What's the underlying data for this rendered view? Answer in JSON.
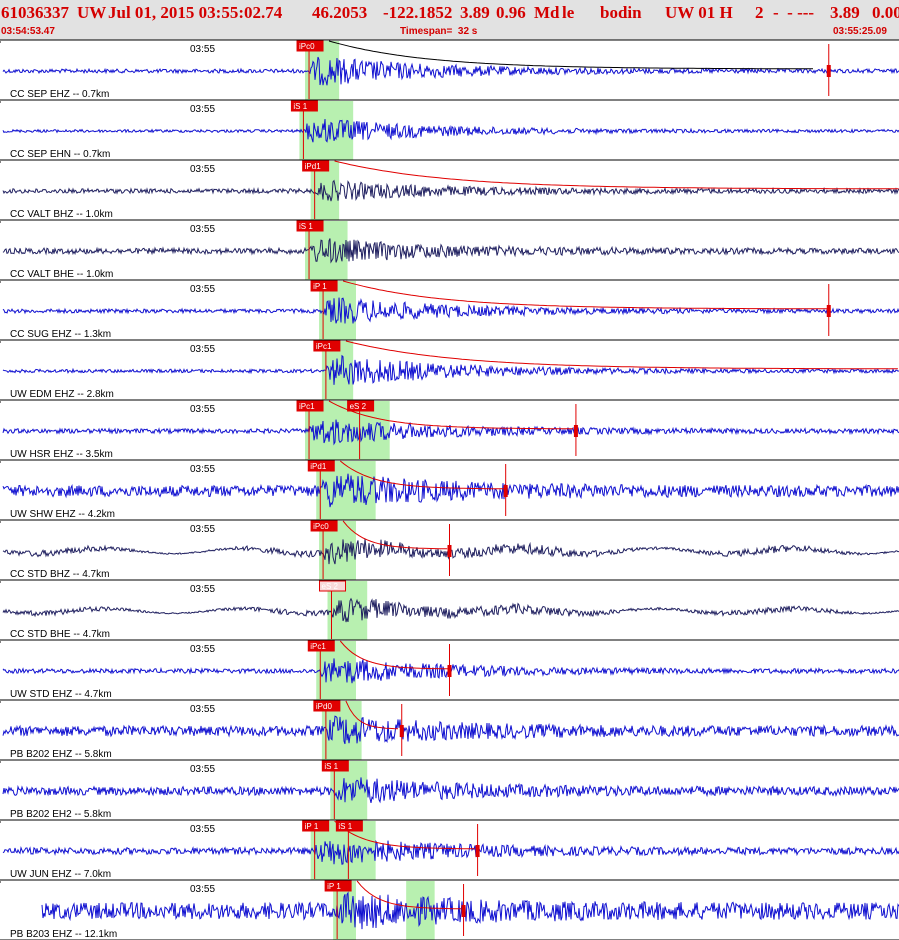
{
  "header": {
    "event_id": "61036337",
    "network": "UW",
    "origin_time": "Jul 01, 2015 03:55:02.74",
    "latitude": "46.2053",
    "longitude": "-122.1852",
    "depth": "3.89",
    "magnitude": "0.96",
    "mag_type": "Md",
    "loc_flag": "le",
    "author": "bodin",
    "source": "UW 01 H",
    "field_a": "2",
    "dashes": "-  - ---",
    "mag_repeat": "3.89",
    "residual": "0.00",
    "start_time": "03:54:53.47",
    "timespan": "Timespan=  32 s",
    "end_time": "03:55:25.09"
  },
  "colors": {
    "header_text": "#d40000",
    "header_bg": "#e2e2e2",
    "pick_box": "#e00000",
    "pick_box_light": "#f8d8d8",
    "window_band": "#b8f0b0",
    "waveform_blue": "#1010d0",
    "waveform_dark": "#202060",
    "coda_fit": "#e00000",
    "coda_fit_first": "#000000",
    "grid": "#000000"
  },
  "chart_data": {
    "type": "seismogram",
    "time_start": "03:54:53.47",
    "time_end": "03:55:25.09",
    "timespan_s": 32,
    "time_tick_label": "03:55",
    "traces": [
      {
        "label": "CC SEP EHZ -- 0.7km",
        "pick": "iPc0",
        "pick_t": 11.0,
        "band": [
          11.0,
          12.0
        ],
        "color": "blue",
        "amp": 0.55,
        "noise": 0.07,
        "coda_end": 29.0,
        "coda_black": true,
        "drop": 29.5,
        "end_t": 32.0
      },
      {
        "label": "CC SEP EHN -- 0.7km",
        "pick": "iS 1",
        "pick_t": 10.8,
        "band": [
          10.8,
          12.5
        ],
        "color": "blue",
        "amp": 0.5,
        "noise": 0.05,
        "end_t": 32.0
      },
      {
        "label": "CC VALT BHZ -- 1.0km",
        "pick": "iPd1",
        "pick_t": 11.2,
        "band": [
          11.2,
          12.0
        ],
        "color": "dark",
        "amp": 0.35,
        "noise": 0.08,
        "coda_end": 32.5,
        "drop": 33.0,
        "end_t": 32.0
      },
      {
        "label": "CC VALT BHE -- 1.0km",
        "pick": "iS 1",
        "pick_t": 11.0,
        "band": [
          11.0,
          12.3
        ],
        "color": "dark",
        "amp": 0.45,
        "noise": 0.1,
        "end_t": 32.0
      },
      {
        "label": "CC SUG EHZ -- 1.3km",
        "pick": "iP 1",
        "pick_t": 11.5,
        "band": [
          11.5,
          12.6
        ],
        "color": "blue",
        "amp": 0.5,
        "noise": 0.07,
        "coda_end": 29.5,
        "drop": 29.5,
        "end_t": 32.0
      },
      {
        "label": "UW EDM EHZ -- 2.8km",
        "pick": "iPc1",
        "pick_t": 11.6,
        "band": [
          11.6,
          12.5
        ],
        "color": "blue",
        "amp": 0.6,
        "noise": 0.06,
        "coda_end": 35.0,
        "end_t": 33.0
      },
      {
        "label": "UW HSR EHZ -- 3.5km",
        "pick": "iPc1",
        "pick_t": 11.0,
        "pick2": "eS 2",
        "pick2_t": 12.8,
        "band": [
          11.0,
          13.8
        ],
        "color": "blue",
        "amp": 0.5,
        "noise": 0.08,
        "coda_end": 20.5,
        "drop": 20.5,
        "end_t": 33.0
      },
      {
        "label": "UW SHW EHZ -- 4.2km",
        "pick": "iPd1",
        "pick_t": 11.4,
        "band": [
          11.4,
          13.3
        ],
        "color": "blue",
        "amp": 0.55,
        "noise": 0.2,
        "coda_end": 18.0,
        "drop": 18.0,
        "end_t": 33.0
      },
      {
        "label": "CC STD BHZ -- 4.7km",
        "pick": "iPc0",
        "pick_t": 11.5,
        "band": [
          11.5,
          12.6
        ],
        "color": "dark",
        "amp": 0.45,
        "noise": 0.12,
        "swell": true,
        "coda_end": 16.0,
        "drop": 16.0,
        "end_t": 33.0
      },
      {
        "label": "CC STD BHE -- 4.7km",
        "pick": "eS 2",
        "pick_t": 11.8,
        "pick_light": true,
        "band": [
          11.8,
          13.0
        ],
        "color": "dark",
        "amp": 0.45,
        "noise": 0.1,
        "swell": true,
        "end_t": 33.0
      },
      {
        "label": "UW STD EHZ -- 4.7km",
        "pick": "iPc1",
        "pick_t": 11.4,
        "band": [
          11.4,
          12.6
        ],
        "color": "blue",
        "amp": 0.5,
        "noise": 0.08,
        "coda_end": 16.0,
        "drop": 16.0,
        "end_t": 33.0
      },
      {
        "label": "PB B202 EHZ -- 5.8km",
        "pick": "iPd0",
        "pick_t": 11.6,
        "band": [
          11.6,
          12.8
        ],
        "color": "blue",
        "amp": 0.45,
        "noise": 0.18,
        "coda_end": 14.3,
        "drop": 14.3,
        "end_t": 33.5
      },
      {
        "label": "PB B202 EH2 -- 5.8km",
        "pick": "iS 1",
        "pick_t": 11.9,
        "band": [
          11.9,
          13.0
        ],
        "color": "blue",
        "amp": 0.45,
        "noise": 0.15,
        "end_t": 33.5
      },
      {
        "label": "UW JUN EHZ -- 7.0km",
        "pick": "iP 1",
        "pick2": "iS 1",
        "pick_t": 11.2,
        "pick2_t": 12.4,
        "band": [
          11.2,
          13.3
        ],
        "color": "blue",
        "amp": 0.5,
        "noise": 0.12,
        "coda_end": 17.0,
        "drop": 17.0,
        "end_t": 34.0
      },
      {
        "label": "PB B203 EHZ -- 12.1km",
        "pick": "iP 1",
        "pick_t": 12.0,
        "band": [
          12.0,
          12.6
        ],
        "band2": [
          14.6,
          15.4
        ],
        "color": "blue",
        "amp": 0.45,
        "noise": 0.3,
        "coda_end": 16.5,
        "drop": 16.5,
        "start_t": 1.5,
        "end_t": 35.0
      }
    ]
  }
}
